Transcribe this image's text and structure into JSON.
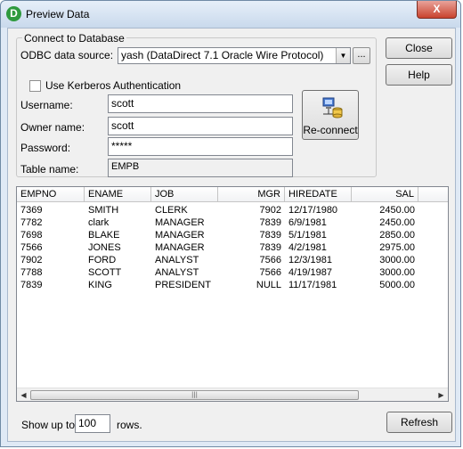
{
  "window": {
    "title": "Preview Data",
    "app_icon": "D",
    "close_glyph": "X"
  },
  "connect": {
    "group_label": "Connect to Database",
    "odbc_label": "ODBC data source:",
    "odbc_value": "yash (DataDirect 7.1 Oracle Wire Protocol)",
    "ellipsis_label": "...",
    "kerberos_label": "Use Kerberos Authentication",
    "kerberos_checked": false,
    "username_label": "Username:",
    "username_value": "scott",
    "owner_label": "Owner name:",
    "owner_value": "scott",
    "password_label": "Password:",
    "password_value": "*****",
    "table_label": "Table name:",
    "table_value": "EMPB",
    "reconnect_label": "Re-connect",
    "reconnect_icon": "network-computer-icon"
  },
  "buttons": {
    "close": "Close",
    "help": "Help",
    "refresh": "Refresh"
  },
  "grid": {
    "columns": [
      "EMPNO",
      "ENAME",
      "JOB",
      "MGR",
      "HIREDATE",
      "SAL"
    ],
    "rows": [
      [
        "7369",
        "SMITH",
        "CLERK",
        "7902",
        "12/17/1980",
        "2450.00"
      ],
      [
        "7782",
        "clark",
        "MANAGER",
        "7839",
        "6/9/1981",
        "2450.00"
      ],
      [
        "7698",
        "BLAKE",
        "MANAGER",
        "7839",
        "5/1/1981",
        "2850.00"
      ],
      [
        "7566",
        "JONES",
        "MANAGER",
        "7839",
        "4/2/1981",
        "2975.00"
      ],
      [
        "7902",
        "FORD",
        "ANALYST",
        "7566",
        "12/3/1981",
        "3000.00"
      ],
      [
        "7788",
        "SCOTT",
        "ANALYST",
        "7566",
        "4/19/1987",
        "3000.00"
      ],
      [
        "7839",
        "KING",
        "PRESIDENT",
        "NULL",
        "11/17/1981",
        "5000.00"
      ]
    ],
    "scroll_left_glyph": "◀",
    "scroll_right_glyph": "▶",
    "scroll_thumb_glyph": "|||"
  },
  "footer": {
    "show_label": "Show up to",
    "rows_value": "100",
    "rows_label": "rows."
  }
}
